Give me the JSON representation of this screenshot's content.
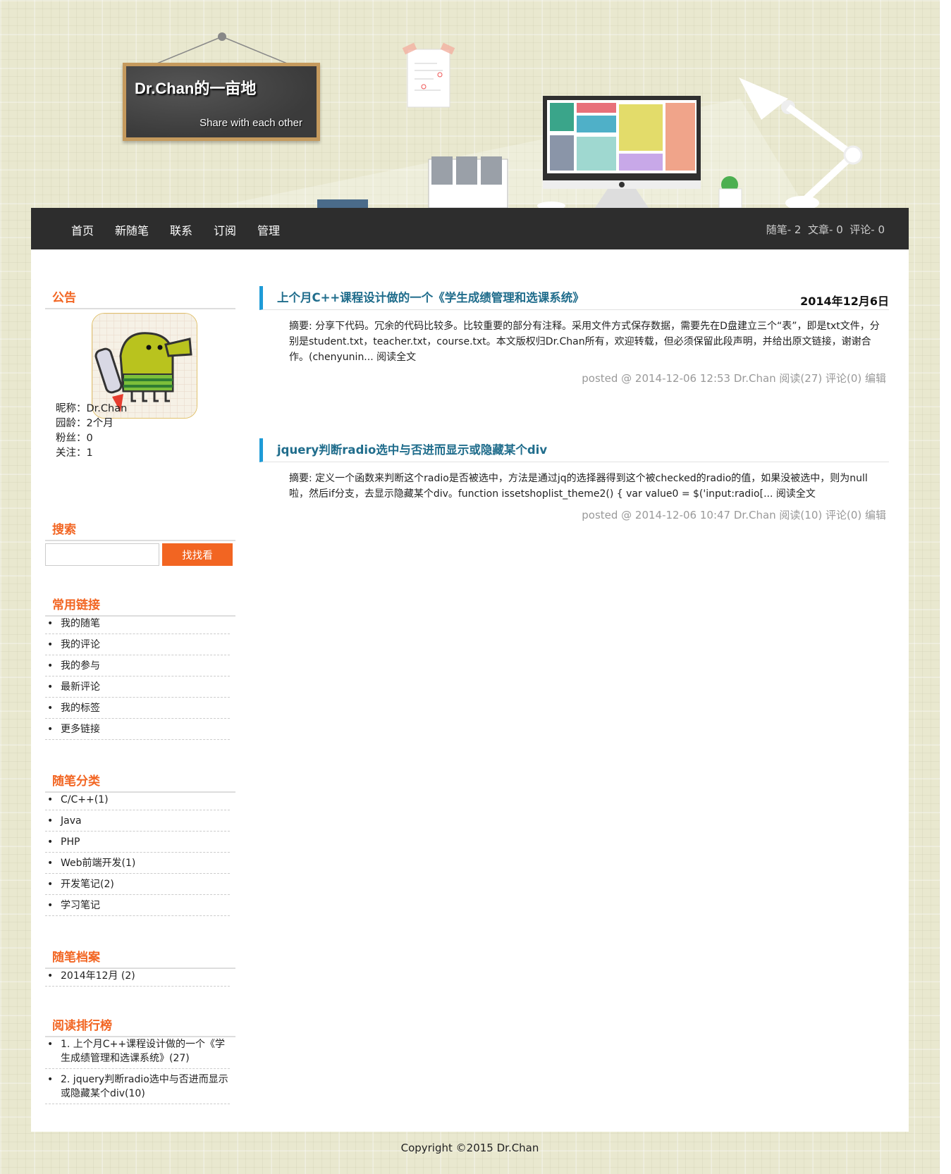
{
  "header": {
    "title": "Dr.Chan的一亩地",
    "subtitle": "Share with each other"
  },
  "nav": {
    "items": [
      "首页",
      "新随笔",
      "联系",
      "订阅",
      "管理"
    ],
    "stats": "随笔- 2  文章- 0  评论- 0"
  },
  "sidebar": {
    "notice_title": "公告",
    "profile": [
      "昵称：Dr.Chan",
      "园龄：2个月",
      "粉丝：0",
      "关注：1"
    ],
    "search_title": "搜索",
    "search_button": "找找看",
    "search_value": "",
    "links_title": "常用链接",
    "links": [
      "我的随笔",
      "我的评论",
      "我的参与",
      "最新评论",
      "我的标签",
      "更多链接"
    ],
    "categories_title": "随笔分类",
    "categories": [
      "C/C++(1)",
      "Java",
      "PHP",
      "Web前端开发(1)",
      "开发笔记(2)",
      "学习笔记"
    ],
    "archive_title": "随笔档案",
    "archive": [
      "2014年12月 (2)"
    ],
    "ranking_title": "阅读排行榜",
    "ranking": [
      "1. 上个月C++课程设计做的一个《学生成绩管理和选课系统》(27)",
      "2. jquery判断radio选中与否进而显示或隐藏某个div(10)"
    ]
  },
  "posts": [
    {
      "title": "上个月C++课程设计做的一个《学生成绩管理和选课系统》",
      "date": "2014年12月6日",
      "summary": "摘要: 分享下代码。冗余的代码比较多。比较重要的部分有注释。采用文件方式保存数据，需要先在D盘建立三个“表”，即是txt文件，分别是student.txt，teacher.txt，course.txt。本文版权归Dr.Chan所有，欢迎转载，但必须保留此段声明，并给出原文链接，谢谢合作。(chenyunin... 阅读全文",
      "footer": "posted @ 2014-12-06 12:53 Dr.Chan 阅读(27) 评论(0) 编辑"
    },
    {
      "title": "jquery判断radio选中与否进而显示或隐藏某个div",
      "date": "",
      "summary": "摘要: 定义一个函数来判断这个radio是否被选中，方法是通过jq的选择器得到这个被checked的radio的值，如果没被选中，则为null啦，然后if分支，去显示隐藏某个div。function issetshoplist_theme2() { var value0 = $('input:radio[... 阅读全文",
      "footer": "posted @ 2014-12-06 10:47 Dr.Chan 阅读(10) 评论(0) 编辑"
    }
  ],
  "footer": {
    "copyright": "Copyright ©2015 Dr.Chan"
  },
  "colors": {
    "accent": "#f26522",
    "post_bar": "#1e9bd7",
    "post_title": "#206d8c",
    "nav_bg": "#2d2d2d"
  }
}
